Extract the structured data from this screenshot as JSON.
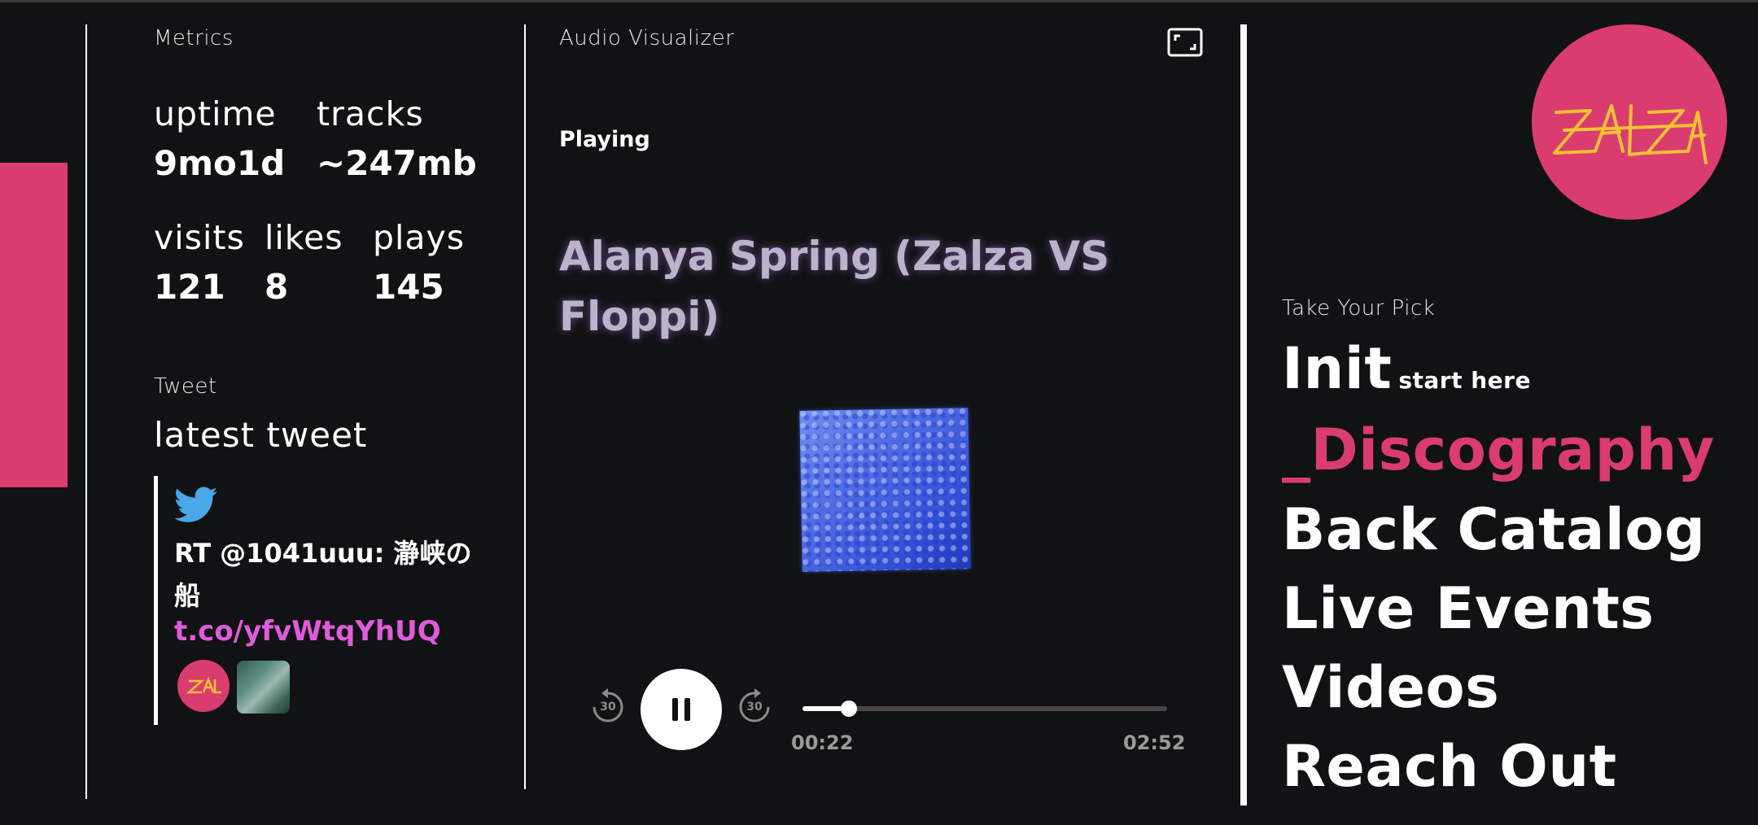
{
  "metrics": {
    "heading": "Metrics",
    "uptime_label": "uptime",
    "uptime_value": "9mo1d",
    "tracks_label": "tracks",
    "tracks_value": "~247mb",
    "visits_label": "visits",
    "visits_value": "121",
    "likes_label": "likes",
    "likes_value": "8",
    "plays_label": "plays",
    "plays_value": "145"
  },
  "tweet": {
    "heading": "Tweet",
    "subheading": "latest tweet",
    "text": "RT @1041uuu: 瀞峡の船",
    "link": "t.co/yfvWtqYhUQ",
    "icons": [
      "twitter-bird-icon",
      "zalza-avatar",
      "attached-image-thumb"
    ]
  },
  "visualizer": {
    "heading": "Audio Visualizer",
    "status": "Playing",
    "title_line1": "Alanya Spring (Zalza VS",
    "title_line2": "Floppi)",
    "current_time": "00:22",
    "total_time": "02:52",
    "progress": 0.128,
    "rewind_label": "30",
    "forward_label": "30"
  },
  "nav": {
    "heading": "Take Your Pick",
    "logo_text": "ZALZA",
    "items": [
      {
        "label": "Init",
        "sub": "start here"
      },
      {
        "label": "_Discography"
      },
      {
        "label": "Back Catalog"
      },
      {
        "label": "Live Events"
      },
      {
        "label": "Videos"
      },
      {
        "label": "Reach Out"
      }
    ]
  },
  "colors": {
    "background": "#111213",
    "accent_pink": "#db3c70",
    "link_pink": "#e05bdc",
    "logo_yellow": "#f2c233",
    "twitter_blue": "#4aa7e8"
  }
}
